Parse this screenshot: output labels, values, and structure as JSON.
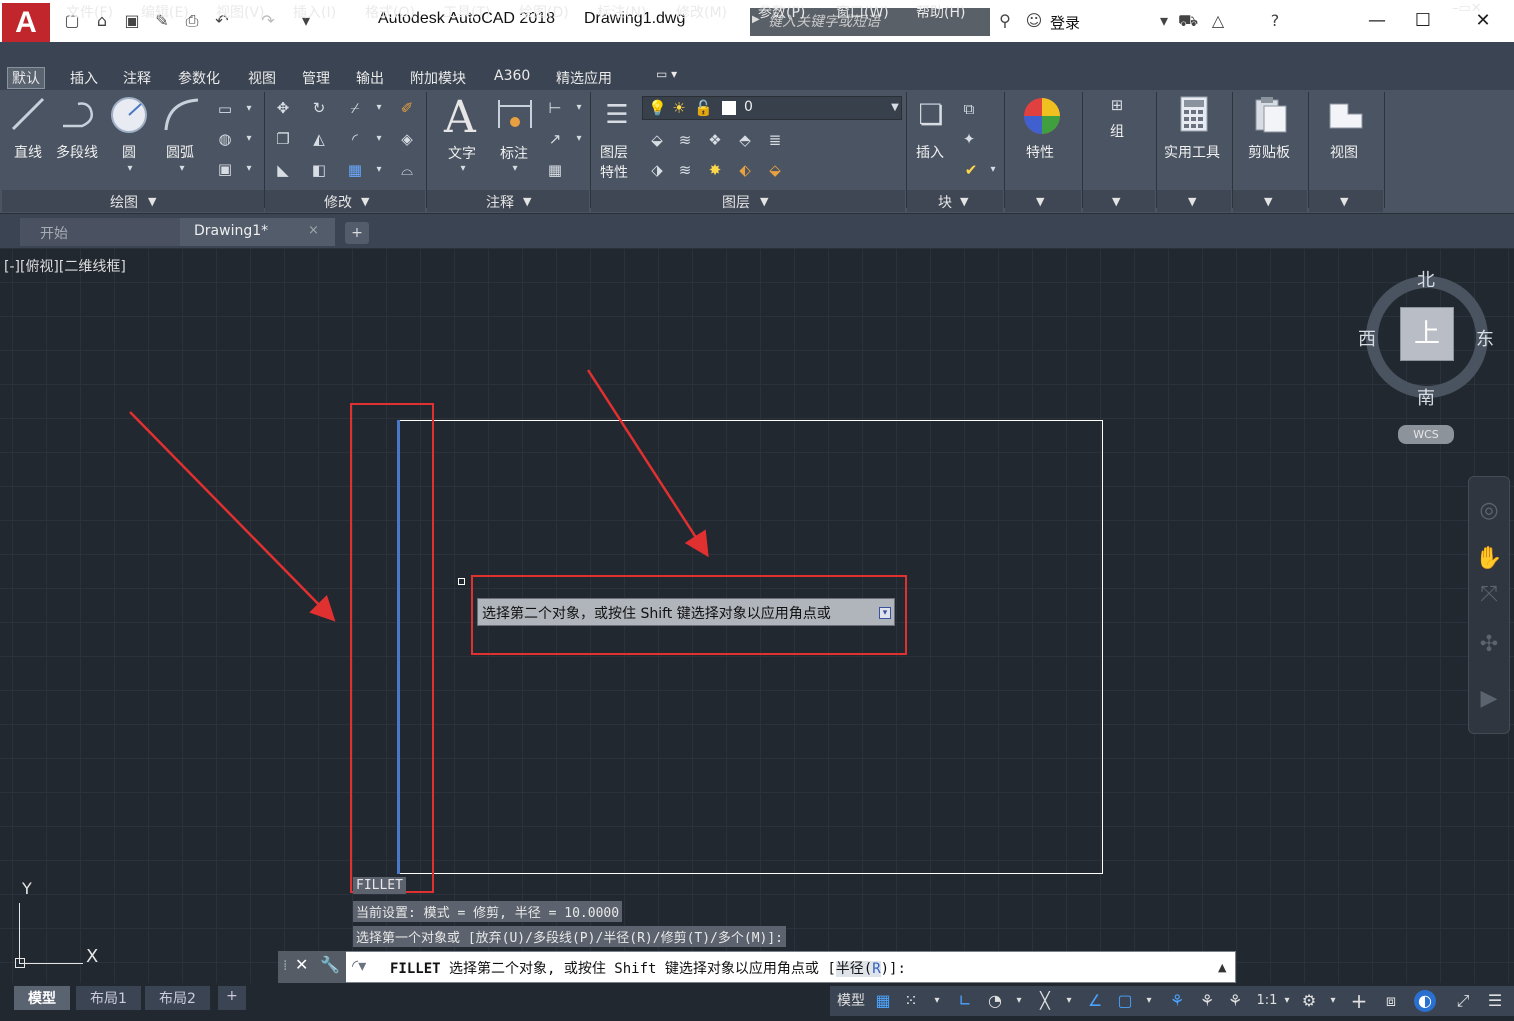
{
  "app": {
    "logo": "A",
    "title": "Autodesk AutoCAD 2018",
    "document": "Drawing1.dwg",
    "search_placeholder": "键入关键字或短语",
    "login": "登录"
  },
  "menu": [
    "文件(F)",
    "编辑(E)",
    "视图(V)",
    "插入(I)",
    "格式(O)",
    "工具(T)",
    "绘图(D)",
    "标注(N)",
    "修改(M)",
    "参数(P)",
    "窗口(W)",
    "帮助(H)"
  ],
  "ribbon_tabs": [
    "默认",
    "插入",
    "注释",
    "参数化",
    "视图",
    "管理",
    "输出",
    "附加模块",
    "A360",
    "精选应用"
  ],
  "ribbon": {
    "draw": {
      "line": "直线",
      "polyline": "多段线",
      "circle": "圆",
      "arc": "圆弧",
      "panel": "绘图"
    },
    "modify": {
      "panel": "修改"
    },
    "annotation": {
      "text": "文字",
      "dimension": "标注",
      "panel": "注释"
    },
    "layers": {
      "props_line1": "图层",
      "props_line2": "特性",
      "current_layer": "0",
      "panel": "图层"
    },
    "block": {
      "insert": "插入",
      "panel": "块"
    },
    "properties": {
      "label": "特性"
    },
    "groups": {
      "label": "组"
    },
    "utilities": {
      "label": "实用工具"
    },
    "clipboard": {
      "label": "剪贴板"
    },
    "view": {
      "label": "视图"
    }
  },
  "file_tabs": {
    "start": "开始",
    "drawing": "Drawing1*",
    "close": "×",
    "add": "+"
  },
  "viewport": {
    "label": "[-][俯视][二维线框]"
  },
  "viewcube": {
    "north": "北",
    "south": "南",
    "east": "东",
    "west": "西",
    "face": "上",
    "wcs": "WCS"
  },
  "tooltip": {
    "text": "选择第二个对象，或按住 Shift 键选择对象以应用角点或"
  },
  "history": {
    "line1": "FILLET",
    "line2": "当前设置: 模式 = 修剪, 半径 = 10.0000",
    "line3": "选择第一个对象或 [放弃(U)/多段线(P)/半径(R)/修剪(T)/多个(M)]:"
  },
  "command": {
    "name": "FILLET",
    "prompt": "选择第二个对象, 或按住 Shift 键选择对象以应用角点或",
    "option_open": "[",
    "option_label": "半径(",
    "option_key": "R",
    "option_close": ")]:"
  },
  "ucs": {
    "y": "Y",
    "x": "X"
  },
  "layout_tabs": [
    "模型",
    "布局1",
    "布局2"
  ],
  "layout_add": "+",
  "status": {
    "model": "模型",
    "scale": "1:1"
  }
}
